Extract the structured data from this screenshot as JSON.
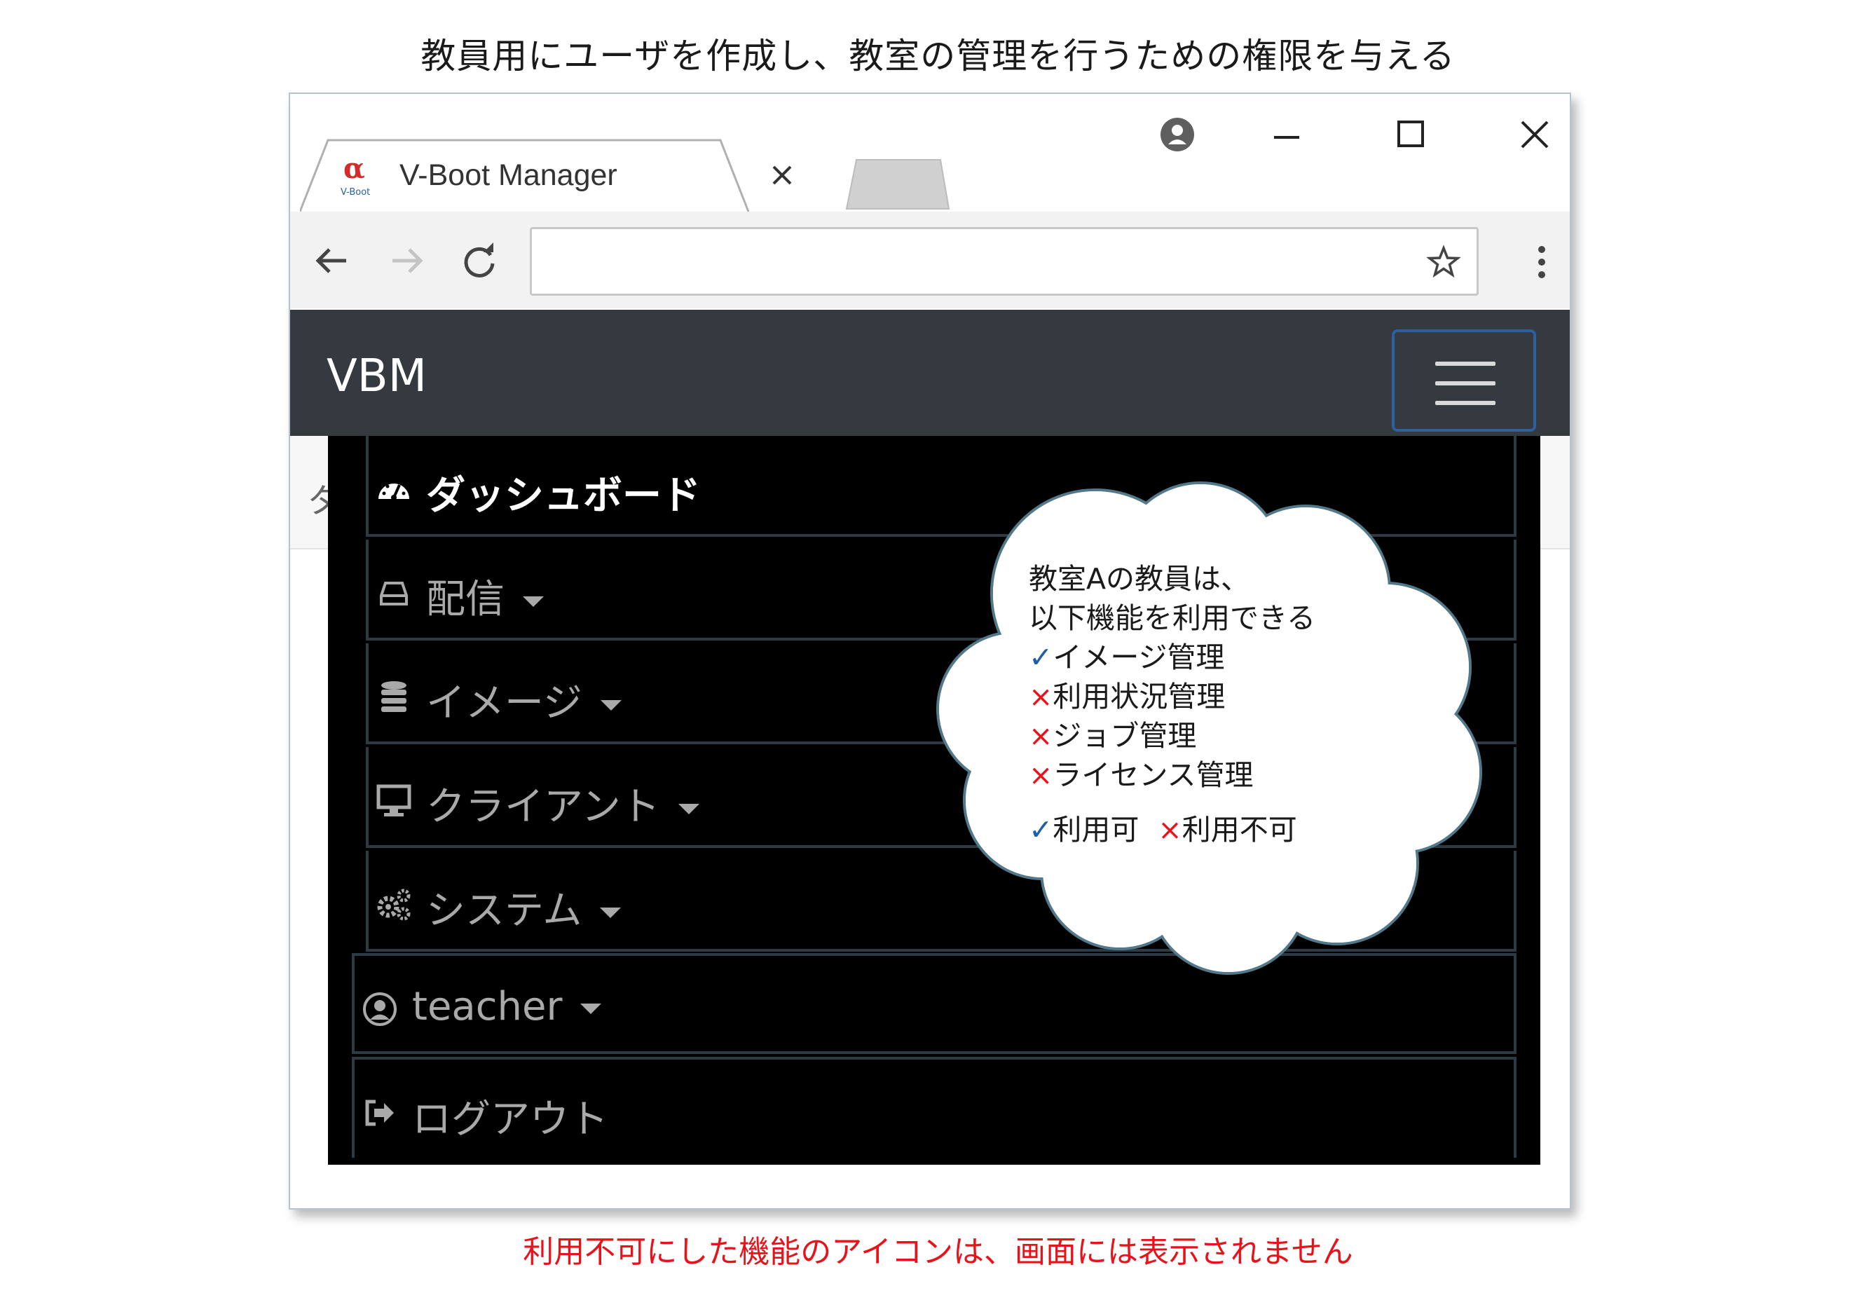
{
  "captions": {
    "top": "教員用にユーザを作成し、教室の管理を行うための権限を与える",
    "bottom": "利用不可にした機能のアイコンは、画面には表示されません"
  },
  "browser": {
    "tab_title": "V-Boot Manager",
    "favicon_text": "V-Boot",
    "address_value": "",
    "icons": [
      "account-circle-icon",
      "minimize-icon",
      "maximize-icon",
      "close-icon",
      "back-arrow-icon",
      "forward-arrow-icon",
      "reload-icon",
      "star-icon",
      "kebab-menu-icon"
    ]
  },
  "app": {
    "brand": "VBM",
    "page_strip_char": "ダ",
    "menu": [
      {
        "label": "ダッシュボード",
        "icon": "dashboard-gauge-icon",
        "active": true,
        "dropdown": false
      },
      {
        "label": "配信",
        "icon": "hard-drive-icon",
        "active": false,
        "dropdown": true
      },
      {
        "label": "イメージ",
        "icon": "database-icon",
        "active": false,
        "dropdown": true
      },
      {
        "label": "クライアント",
        "icon": "monitor-icon",
        "active": false,
        "dropdown": true
      },
      {
        "label": "システム",
        "icon": "gears-icon",
        "active": false,
        "dropdown": true
      },
      {
        "label": "teacher",
        "icon": "user-circle-icon",
        "active": false,
        "dropdown": true
      },
      {
        "label": "ログアウト",
        "icon": "sign-out-icon",
        "active": false,
        "dropdown": false
      }
    ]
  },
  "callout": {
    "line1": "教室Aの教員は、",
    "line2": "以下機能を利用できる",
    "items": [
      {
        "mark": "✓",
        "status": "ok",
        "text": "イメージ管理"
      },
      {
        "mark": "×",
        "status": "ng",
        "text": "利用状況管理"
      },
      {
        "mark": "×",
        "status": "ng",
        "text": "ジョブ管理"
      },
      {
        "mark": "×",
        "status": "ng",
        "text": "ライセンス管理"
      }
    ],
    "legend": {
      "ok_mark": "✓",
      "ok_text": "利用可",
      "ng_mark": "×",
      "ng_text": "利用不可"
    }
  },
  "colors": {
    "navbar": "#343a40",
    "menu_bg": "#000000",
    "menu_text": "#a9a9a9",
    "ok": "#1f5fa8",
    "ng": "#e8121b",
    "cloud_border": "#52788a"
  }
}
